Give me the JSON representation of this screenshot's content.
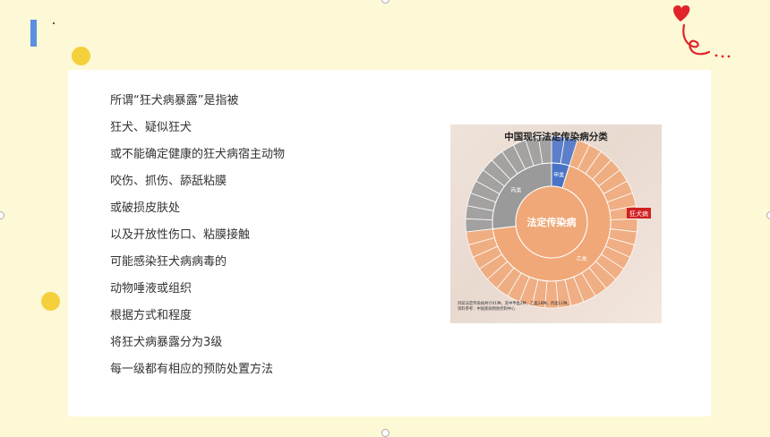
{
  "colors": {
    "background": "#fdf8d6",
    "accent_bar": "#5b8fe0",
    "dot": "#f6cf3c",
    "category_jia": "#4a73c8",
    "category_yi": "#f0a878",
    "category_bing": "#9a9a9a",
    "highlight": "#d11f1f"
  },
  "body_text": {
    "lines": [
      "所谓“狂犬病暴露”是指被",
      "狂犬、疑似狂犬",
      "或不能确定健康的狂犬病宿主动物",
      "咬伤、抓伤、舔舐粘膜",
      "或破损皮肤处",
      "以及开放性伤口、粘膜接触",
      "可能感染狂犬病病毒的",
      "动物唾液或组织",
      "根据方式和程度",
      "将狂犬病暴露分为3级",
      "每一级都有相应的预防处置方法"
    ]
  },
  "figure": {
    "title": "中国现行法定传染病分类",
    "center_label": "法定传染病",
    "category_jia": "甲类",
    "category_yi": "乙类",
    "category_bing": "丙类",
    "callout": "狂犬病",
    "note_line1": "目前法定传染病共计41种，其中甲类2种，乙类28种，丙类11种。",
    "note_line2": "资料参考：中国疾病预防控制中心"
  },
  "chart_data": {
    "type": "pie",
    "title": "中国现行法定传染病分类",
    "center_label": "法定传染病",
    "categories": [
      "甲类",
      "乙类",
      "丙类"
    ],
    "values": [
      2,
      28,
      11
    ],
    "highlight": "狂犬病"
  }
}
